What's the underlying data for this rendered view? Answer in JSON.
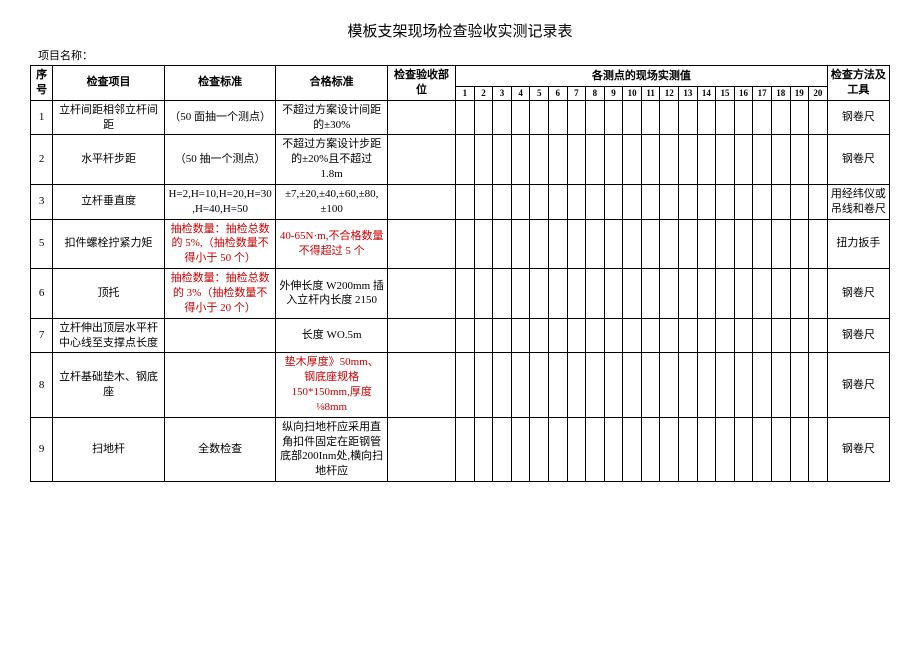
{
  "title": "模板支架现场检查验收实测记录表",
  "project_label": "项目名称：",
  "headers": {
    "seq": "序号",
    "item": "检查项目",
    "std": "检查标准",
    "pass": "合格标准",
    "part": "检查验收部位",
    "measure": "各测点的现场实测值",
    "method": "检查方法及工具",
    "nums": [
      "1",
      "2",
      "3",
      "4",
      "5",
      "6",
      "7",
      "8",
      "9",
      "10",
      "11",
      "12",
      "13",
      "14",
      "15",
      "16",
      "17",
      "18",
      "19",
      "20"
    ]
  },
  "rows": [
    {
      "seq": "1",
      "item": "立杆间距相邻立杆间距",
      "std": "（50 面抽一个测点）",
      "pass": "不超过方案设计间距的±30%",
      "method": "钢卷尺",
      "pass_red": false,
      "std_red": false
    },
    {
      "seq": "2",
      "item": "水平杆步距",
      "std": "（50 抽一个测点）",
      "pass": "不超过方案设计步距的±20%且不超过 1.8m",
      "method": "钢卷尺",
      "pass_red": false,
      "std_red": false
    },
    {
      "seq": "3",
      "item": "立杆垂直度",
      "std": "H=2,H=10,H=20,H=30,H=40,H=50",
      "pass": "±7,±20,±40,±60,±80,±100",
      "method": "用经纬仪或吊线和卷尺",
      "pass_red": false,
      "std_red": false
    },
    {
      "seq": "5",
      "item": "扣件螺栓拧紧力矩",
      "std": "抽检数量：抽检总数的 5%,（抽检数量不得小于 50 个）",
      "pass": "40-65N·m,不合格数量不得超过 5 个",
      "method": "扭力扳手",
      "pass_red": true,
      "std_red": true
    },
    {
      "seq": "6",
      "item": "顶托",
      "std": "抽检数量：抽检总数的 3%（抽检数量不得小于 20 个）",
      "pass": "外伸长度 W200mm 插入立杆内长度 2150",
      "method": "钢卷尺",
      "pass_red": false,
      "std_red": true
    },
    {
      "seq": "7",
      "item": "立杆伸出顶层水平杆中心线至支撑点长度",
      "std": "",
      "pass": "长度 WO.5m",
      "method": "钢卷尺",
      "pass_red": false,
      "std_red": false
    },
    {
      "seq": "8",
      "item": "立杆基础垫木、钢底座",
      "std": "",
      "pass": "垫木厚度》50mm、钢底座规格150*150mm,厚度⅛8mm",
      "method": "钢卷尺",
      "pass_red": true,
      "std_red": false
    },
    {
      "seq": "9",
      "item": "扫地杆",
      "std": "全数检查",
      "pass": "纵向扫地杆应采用直角扣件固定在距钢管底部200Inm处,横向扫地杆应",
      "method": "钢卷尺",
      "pass_red": false,
      "std_red": false
    }
  ]
}
